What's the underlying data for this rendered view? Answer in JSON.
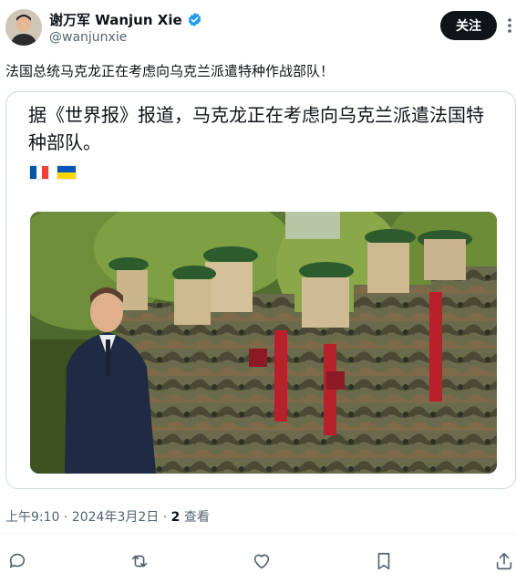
{
  "author": {
    "display_name": "谢万军 Wanjun Xie",
    "handle": "@wanjunxie",
    "verified_color": "#1d9bf0"
  },
  "follow_button": {
    "label": "关注"
  },
  "more_icon": "ellipsis-icon",
  "tweet": {
    "text": "法国总统马克龙正在考虑向乌克兰派遣特种作战部队！"
  },
  "quoted_card": {
    "text": "据《世界报》报道，马克龙正在考虑向乌克兰派遣法国特种部队。",
    "flags": [
      "france-flag",
      "ukraine-flag"
    ],
    "image": "photo-macron-reviewing-masked-soldiers"
  },
  "meta": {
    "time": "上午9:10",
    "separator": " · ",
    "date": "2024年3月2日",
    "views_count": "2",
    "views_label": " 查看"
  },
  "actions": [
    "reply-icon",
    "repost-icon",
    "like-icon",
    "bookmark-icon",
    "share-icon"
  ],
  "colors": {
    "text": "#0f1419",
    "secondary": "#536471",
    "border": "#cfd9de"
  }
}
